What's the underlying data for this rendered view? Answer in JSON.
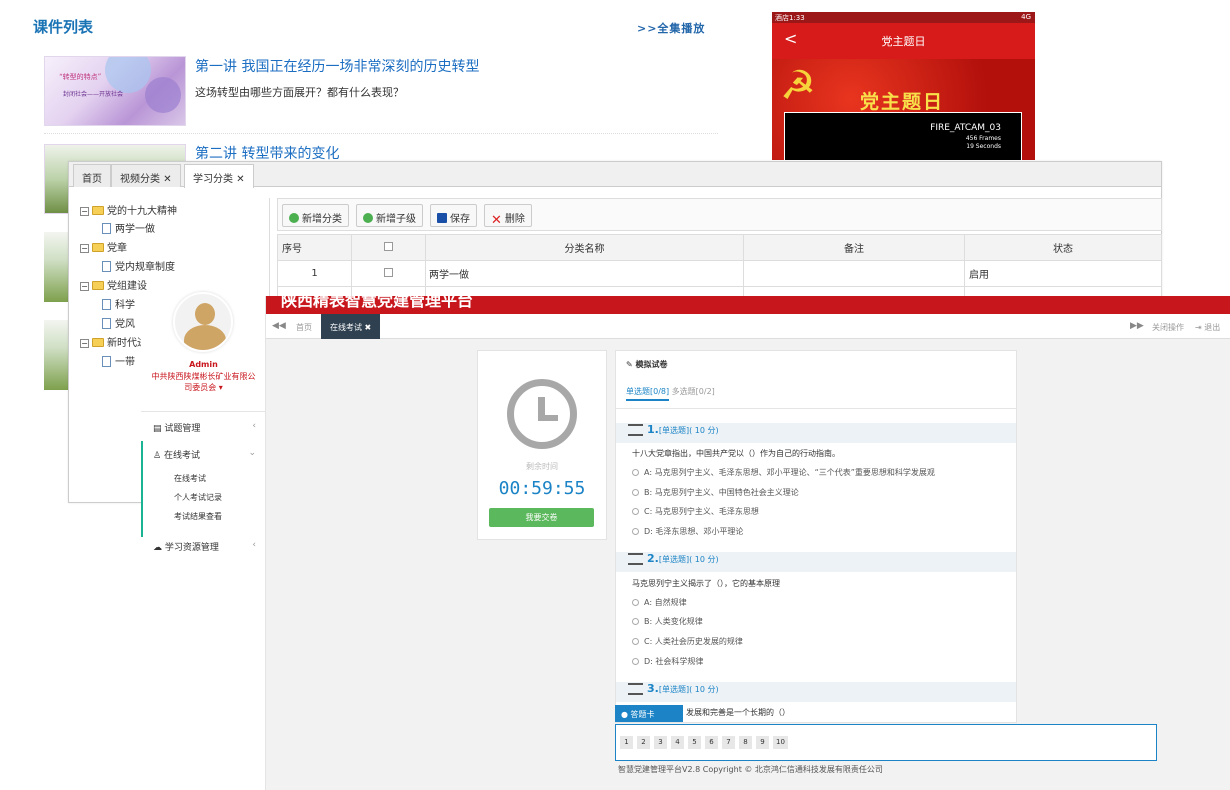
{
  "course_list": {
    "title": "课件列表",
    "play_all": ">>全集播放",
    "courses": [
      {
        "title": "第一讲 我国正在经历一场非常深刻的历史转型",
        "desc": "这场转型由哪些方面展开？都有什么表现？",
        "thumb_title": "“转型的特点”",
        "thumb_sub": "封闭社会——开放社会"
      },
      {
        "title": "第二讲 转型带来的变化"
      }
    ]
  },
  "phone": {
    "status_time": "酒店1:33",
    "status_right": "4G",
    "back": "<",
    "nav_title": "党主题日",
    "banner_text": "党主题日",
    "emblem": "☭",
    "video_title": "FIRE_ATCAM_03",
    "video_frames": "456 Frames",
    "video_seconds": "19 Seconds"
  },
  "category_admin": {
    "tabs": [
      {
        "label": "首页",
        "closable": false,
        "active": false
      },
      {
        "label": "视频分类",
        "closable": true,
        "active": false
      },
      {
        "label": "学习分类",
        "closable": true,
        "active": true
      }
    ],
    "tree": [
      {
        "label": "党的十九大精神",
        "type": "folder",
        "level": 0
      },
      {
        "label": "两学一做",
        "type": "file",
        "level": 1
      },
      {
        "label": "党章",
        "type": "folder",
        "level": 0
      },
      {
        "label": "党内规章制度",
        "type": "file",
        "level": 1
      },
      {
        "label": "党组建设",
        "type": "folder",
        "level": 0
      },
      {
        "label": "科学",
        "type": "file",
        "level": 1
      },
      {
        "label": "党风",
        "type": "file",
        "level": 1
      },
      {
        "label": "新时代进",
        "type": "folder",
        "level": 0
      },
      {
        "label": "一带",
        "type": "file",
        "level": 1
      }
    ],
    "toolbar": {
      "add_category": "新增分类",
      "add_child": "新增子级",
      "save": "保存",
      "delete": "删除"
    },
    "columns": {
      "index": "序号",
      "name": "分类名称",
      "remark": "备注",
      "status": "状态"
    },
    "rows": [
      {
        "index": "1",
        "name": "两学一做",
        "remark": "",
        "status": "启用"
      }
    ]
  },
  "exam": {
    "platform_title": "陕西精表智慧党建管理平台",
    "user": {
      "name": "Admin",
      "org": "中共陕西陕煤彬长矿业有限公司委员会 ▾"
    },
    "menu": {
      "question_mgmt": "试题管理",
      "online_exam": "在线考试",
      "sub": [
        "在线考试",
        "个人考试记录",
        "考试结果查看"
      ],
      "learning_mgmt": "学习资源管理"
    },
    "tabstrip": {
      "prev": "◀◀",
      "home": "首页",
      "current": "在线考试 ✖",
      "next": "▶▶",
      "close_ops": "关闭操作",
      "exit": "⇥ 退出"
    },
    "timer": {
      "label": "剩余时间",
      "value": "00:59:55",
      "submit": "我要交卷"
    },
    "paper": {
      "title": "模拟试卷",
      "tab_single": "单选题[0/8]",
      "tab_multi": "多选题[0/2]",
      "questions": [
        {
          "num": "1.",
          "type": "[单选题]",
          "score": "( 10 分)",
          "stem": "十八大党章指出，中国共产党以（）作为自己的行动指南。",
          "options": [
            "A: 马克思列宁主义、毛泽东思想、邓小平理论、“三个代表”重要思想和科学发展观",
            "B: 马克思列宁主义、中国特色社会主义理论",
            "C: 马克思列宁主义、毛泽东思想",
            "D: 毛泽东思想、邓小平理论"
          ]
        },
        {
          "num": "2.",
          "type": "[单选题]",
          "score": "( 10 分)",
          "stem": "马克思列宁主义揭示了（），它的基本原理",
          "options": [
            "A: 自然规律",
            "B: 人类变化规律",
            "C: 人类社会历史发展的规律",
            "D: 社会科学规律"
          ]
        },
        {
          "num": "3.",
          "type": "[单选题]",
          "score": "( 10 分)",
          "stem": "发展和完善是一个长期的（）"
        }
      ]
    },
    "answer_card": {
      "title": "答题卡",
      "numbers": [
        "1",
        "2",
        "3",
        "4",
        "5",
        "6",
        "7",
        "8",
        "9",
        "10"
      ]
    },
    "footer": "智慧党建管理平台V2.8 Copyright © 北京鸿仁信通科技发展有限责任公司"
  }
}
